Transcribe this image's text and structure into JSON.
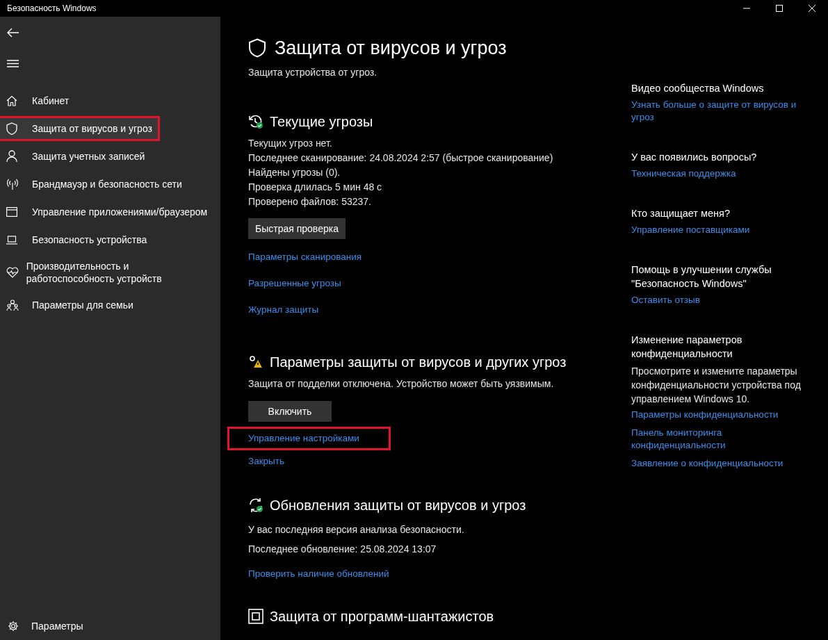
{
  "window": {
    "title": "Безопасность Windows"
  },
  "sidebar": {
    "items": [
      {
        "label": "Кабинет",
        "selected": false,
        "highlighted": false
      },
      {
        "label": "Защита от вирусов и угроз",
        "selected": true,
        "highlighted": true
      },
      {
        "label": "Защита учетных записей",
        "selected": false,
        "highlighted": false
      },
      {
        "label": "Брандмауэр и безопасность сети",
        "selected": false,
        "highlighted": false
      },
      {
        "label": "Управление приложениями/браузером",
        "selected": false,
        "highlighted": false
      },
      {
        "label": "Безопасность устройства",
        "selected": false,
        "highlighted": false
      },
      {
        "label": "Производительность и работоспособность устройств",
        "selected": false,
        "highlighted": false
      },
      {
        "label": "Параметры для семьи",
        "selected": false,
        "highlighted": false
      }
    ],
    "footer": {
      "label": "Параметры"
    }
  },
  "main": {
    "title": "Защита от вирусов и угроз",
    "subtitle": "Защита устройства от угроз.",
    "sections": [
      {
        "heading": "Текущие угрозы",
        "lines": [
          "Текущих угроз нет.",
          "Последнее сканирование: 24.08.2024 2:57 (быстрое сканирование)",
          "Найдены угрозы (0).",
          "Проверка длилась 5 мин 48 с",
          "Проверено файлов: 53237."
        ],
        "button": {
          "label": "Быстрая проверка"
        },
        "links": [
          {
            "label": "Параметры сканирования",
            "highlighted": false
          },
          {
            "label": "Разрешенные угрозы",
            "highlighted": false
          },
          {
            "label": "Журнал защиты",
            "highlighted": false
          }
        ]
      },
      {
        "heading": "Параметры защиты от вирусов и других угроз",
        "lines": [
          "Защита от подделки отключена. Устройство может быть уязвимым."
        ],
        "button": {
          "label": "Включить"
        },
        "links": [
          {
            "label": "Управление настройками",
            "highlighted": true
          },
          {
            "label": "Закрыть",
            "highlighted": false
          }
        ]
      },
      {
        "heading": "Обновления защиты от вирусов и угроз",
        "lines": [
          "У вас последняя версия анализа безопасности.",
          "Последнее обновление: 25.08.2024 13:07"
        ],
        "links": [
          {
            "label": "Проверить наличие обновлений",
            "highlighted": false
          }
        ]
      },
      {
        "heading": "Защита от программ-шантажистов"
      }
    ]
  },
  "aside": {
    "groups": [
      {
        "heading": "Видео сообщества Windows",
        "links": [
          "Узнать больше о защите от вирусов и угроз"
        ]
      },
      {
        "heading": "У вас появились вопросы?",
        "links": [
          "Техническая поддержка"
        ]
      },
      {
        "heading": "Кто защищает меня?",
        "links": [
          "Управление поставщиками"
        ]
      },
      {
        "heading": "Помощь в улучшении службы \"Безопасность Windows\"",
        "links": [
          "Оставить отзыв"
        ]
      },
      {
        "heading": "Изменение параметров конфиденциальности",
        "text": "Просмотрите и измените параметры конфиденциальности устройства под управлением Windows 10.",
        "links": [
          "Параметры конфиденциальности",
          "Панель мониторинга конфиденциальности",
          "Заявление о конфиденциальности"
        ]
      }
    ]
  }
}
